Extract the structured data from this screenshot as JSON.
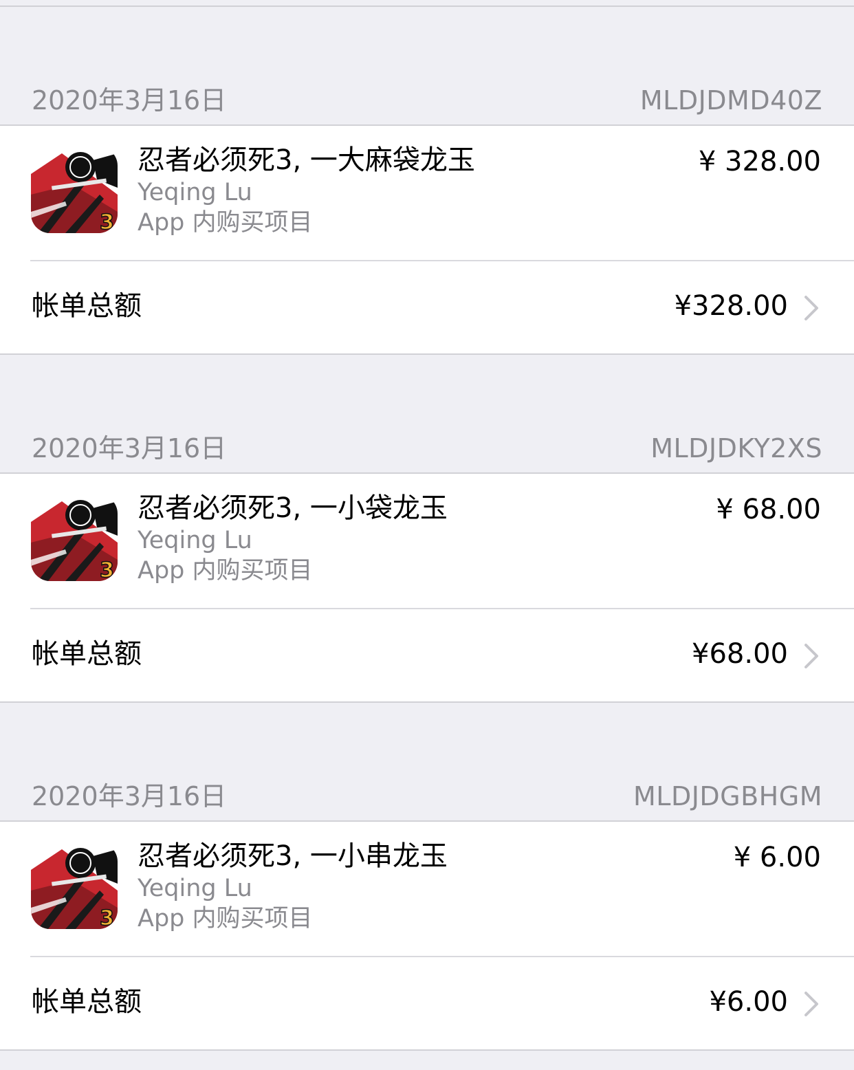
{
  "receipts": [
    {
      "date": "2020年3月16日",
      "order_id": "MLDJDMD40Z",
      "item": {
        "title": "忍者必须死3, 一大麻袋龙玉",
        "seller": "Yeqing Lu",
        "type": "App 内购买项目",
        "price": "¥ 328.00",
        "icon": "ninja-game-app-icon"
      },
      "total_label": "帐单总额",
      "total_amount": "¥328.00"
    },
    {
      "date": "2020年3月16日",
      "order_id": "MLDJDKY2XS",
      "item": {
        "title": "忍者必须死3, 一小袋龙玉",
        "seller": "Yeqing Lu",
        "type": "App 内购买项目",
        "price": "¥ 68.00",
        "icon": "ninja-game-app-icon"
      },
      "total_label": "帐单总额",
      "total_amount": "¥68.00"
    },
    {
      "date": "2020年3月16日",
      "order_id": "MLDJDGBHGM",
      "item": {
        "title": "忍者必须死3, 一小串龙玉",
        "seller": "Yeqing Lu",
        "type": "App 内购买项目",
        "price": "¥ 6.00",
        "icon": "ninja-game-app-icon"
      },
      "total_label": "帐单总额",
      "total_amount": "¥6.00"
    }
  ],
  "colors": {
    "background": "#efeff4",
    "card": "#ffffff",
    "secondary_text": "#8a8a8f",
    "separator": "#d1d1d6",
    "chevron": "#c7c7cc",
    "icon_red": "#c8272f"
  }
}
